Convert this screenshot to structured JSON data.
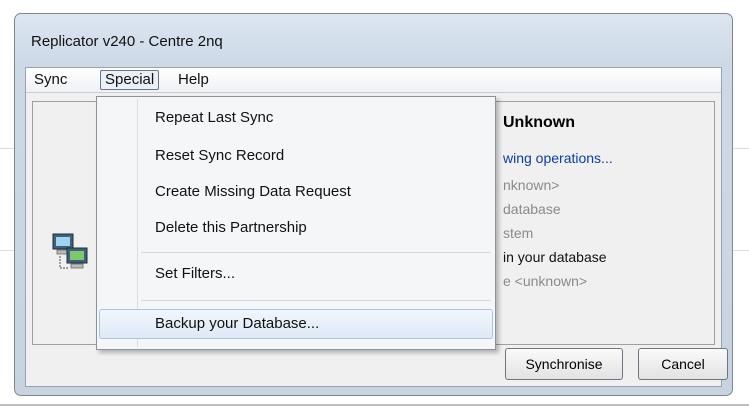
{
  "window": {
    "title": "Replicator v240 - Centre 2nq"
  },
  "menubar": {
    "sync": "Sync",
    "special": "Special",
    "help": "Help"
  },
  "special_menu": {
    "items": [
      "Repeat Last Sync",
      "Reset Sync Record",
      "Create Missing Data Request",
      "Delete this Partnership",
      "Set Filters...",
      "Backup your Database..."
    ],
    "highlighted": "Backup your Database..."
  },
  "panel": {
    "heading": "Unknown",
    "operations_label": "wing operations...",
    "operations": [
      {
        "text": "nknown>",
        "active": false
      },
      {
        "text": "database",
        "active": false
      },
      {
        "text": "stem",
        "active": false
      },
      {
        "text": "in your database",
        "active": true
      },
      {
        "text": "e <unknown>",
        "active": false
      }
    ]
  },
  "buttons": {
    "synchronise": "Synchronise",
    "cancel": "Cancel"
  },
  "icons": {
    "computer": "network-computers-icon"
  },
  "colors": {
    "ops_label": "#0a3da8",
    "highlight_border": "#a9c5e6"
  }
}
